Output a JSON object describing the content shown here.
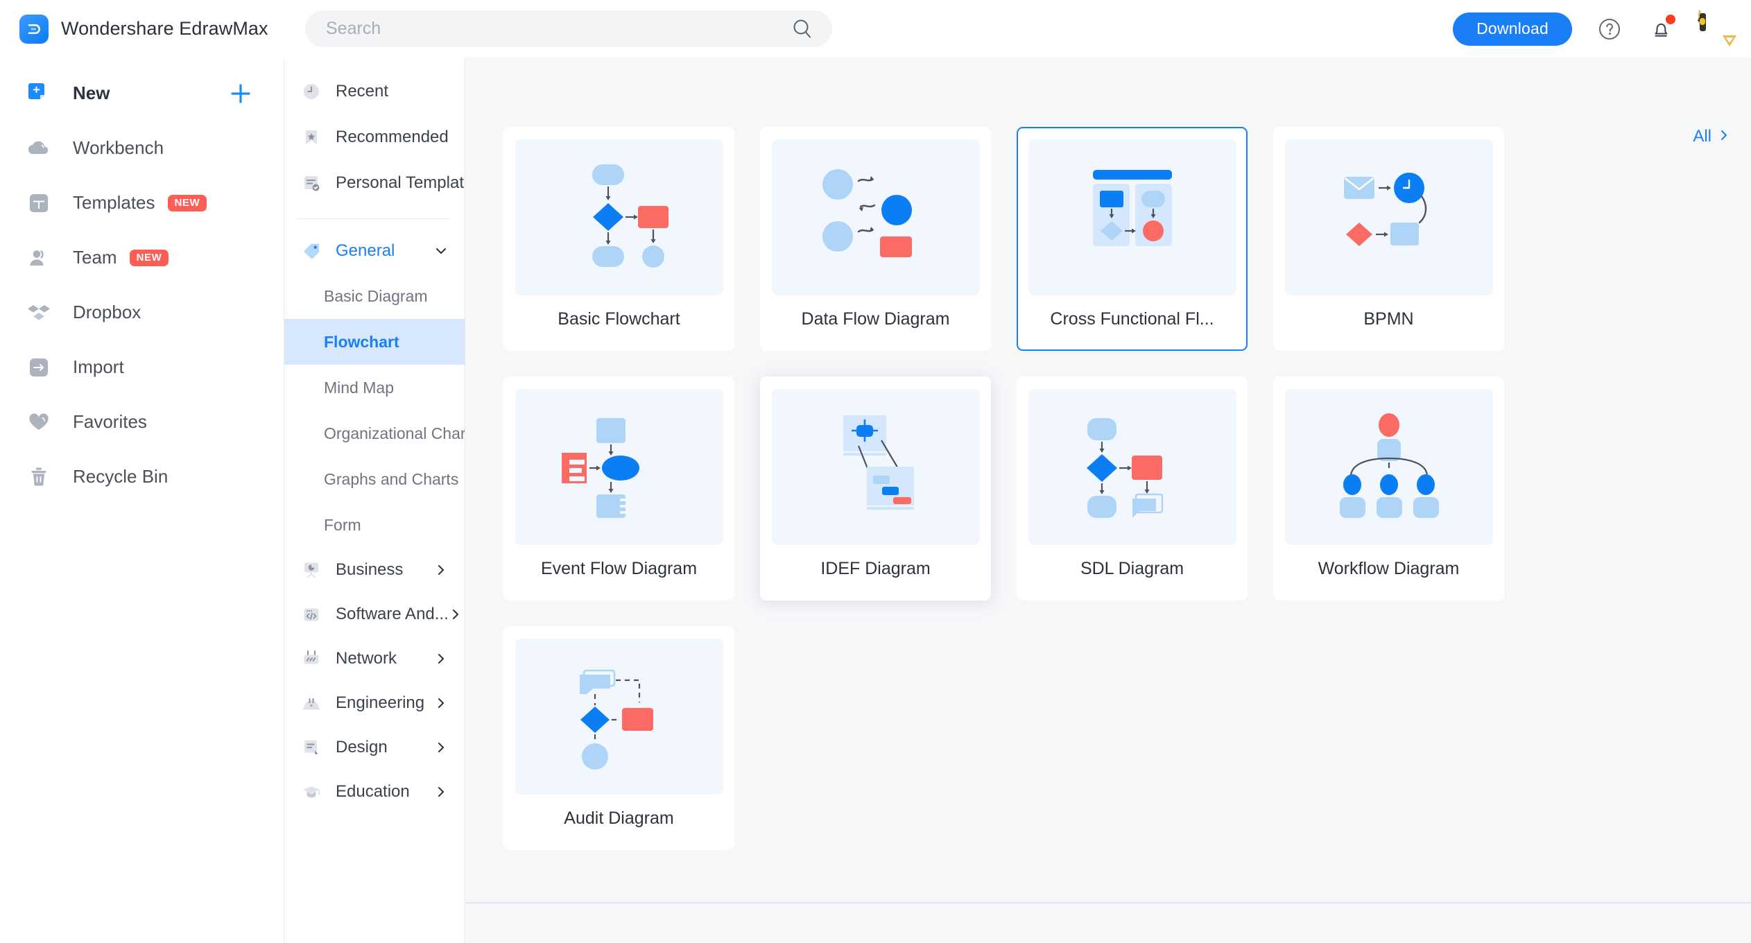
{
  "app": {
    "brand_name": "Wondershare EdrawMax",
    "logo_icon": "edrawmax-logo-icon"
  },
  "header": {
    "search": {
      "placeholder": "Search",
      "value": "",
      "icon": "search-icon"
    },
    "download_label": "Download",
    "help_icon": "question-circle-icon",
    "notification_icon": "bell-icon",
    "notification_has_unread": true,
    "avatar_icon": "user-avatar",
    "vip_badge_icon": "vip-crown-badge-icon",
    "accent_color": "#1a7ef6"
  },
  "sidebar": {
    "items": [
      {
        "label": "New",
        "icon": "new-document-icon",
        "badge": "",
        "primary": true,
        "action_icon": "plus-icon"
      },
      {
        "label": "Workbench",
        "icon": "cloud-icon",
        "badge": ""
      },
      {
        "label": "Templates",
        "icon": "templates-icon",
        "badge": "NEW"
      },
      {
        "label": "Team",
        "icon": "team-people-icon",
        "badge": "NEW"
      },
      {
        "label": "Dropbox",
        "icon": "dropbox-icon",
        "badge": ""
      },
      {
        "label": "Import",
        "icon": "import-arrow-icon",
        "badge": ""
      },
      {
        "label": "Favorites",
        "icon": "heart-icon",
        "badge": ""
      },
      {
        "label": "Recycle Bin",
        "icon": "trash-icon",
        "badge": ""
      }
    ],
    "badge_color": "#fb5e55"
  },
  "category_panel": {
    "top_items": [
      {
        "label": "Recent",
        "icon": "clock-icon"
      },
      {
        "label": "Recommended",
        "icon": "bookmark-star-icon"
      },
      {
        "label": "Personal Template",
        "icon": "personal-template-icon"
      }
    ],
    "groups": [
      {
        "label": "General",
        "icon": "tag-icon",
        "expanded": true,
        "chevron": "chevron-down-icon",
        "children": [
          {
            "label": "Basic Diagram",
            "selected": false
          },
          {
            "label": "Flowchart",
            "selected": true
          },
          {
            "label": "Mind Map",
            "selected": false
          },
          {
            "label": "Organizational Chart",
            "selected": false
          },
          {
            "label": "Graphs and Charts",
            "selected": false
          },
          {
            "label": "Form",
            "selected": false
          }
        ]
      },
      {
        "label": "Business",
        "icon": "presentation-chart-icon",
        "expanded": false,
        "chevron": "chevron-right-icon",
        "children": []
      },
      {
        "label": "Software And...",
        "icon": "code-brackets-icon",
        "expanded": false,
        "chevron": "chevron-right-icon",
        "children": []
      },
      {
        "label": "Network",
        "icon": "network-rack-icon",
        "expanded": false,
        "chevron": "chevron-right-icon",
        "children": []
      },
      {
        "label": "Engineering",
        "icon": "hard-hat-icon",
        "expanded": false,
        "chevron": "chevron-right-icon",
        "children": []
      },
      {
        "label": "Design",
        "icon": "design-pencil-icon",
        "expanded": false,
        "chevron": "chevron-right-icon",
        "children": []
      },
      {
        "label": "Education",
        "icon": "graduation-cap-icon",
        "expanded": false,
        "chevron": "chevron-right-icon",
        "children": []
      }
    ],
    "selected_color": "#1a7ef6",
    "selected_bg": "#d7e7fd"
  },
  "main": {
    "all_link_label": "All",
    "all_link_icon": "chevron-right-icon",
    "cards": [
      {
        "title": "Basic Flowchart",
        "thumb": "basic-flowchart-thumb",
        "selected": false,
        "hovered": false
      },
      {
        "title": "Data Flow Diagram",
        "thumb": "data-flow-diagram-thumb",
        "selected": false,
        "hovered": false
      },
      {
        "title": "Cross Functional Fl...",
        "thumb": "cross-functional-flowchart-thumb",
        "selected": true,
        "hovered": false
      },
      {
        "title": "BPMN",
        "thumb": "bpmn-thumb",
        "selected": false,
        "hovered": false
      },
      {
        "title": "Event Flow Diagram",
        "thumb": "event-flow-diagram-thumb",
        "selected": false,
        "hovered": false
      },
      {
        "title": "IDEF Diagram",
        "thumb": "idef-diagram-thumb",
        "selected": false,
        "hovered": true
      },
      {
        "title": "SDL Diagram",
        "thumb": "sdl-diagram-thumb",
        "selected": false,
        "hovered": false
      },
      {
        "title": "Workflow Diagram",
        "thumb": "workflow-diagram-thumb",
        "selected": false,
        "hovered": false
      },
      {
        "title": "Audit Diagram",
        "thumb": "audit-diagram-thumb",
        "selected": false,
        "hovered": false
      }
    ],
    "background": "#f6f7f9",
    "thumb_background": "#f2f6fd",
    "shape_colors": {
      "light_blue": "#aed4f8",
      "blue": "#0b7ef3",
      "red": "#fb6a63",
      "arrow": "#4d525c"
    }
  }
}
